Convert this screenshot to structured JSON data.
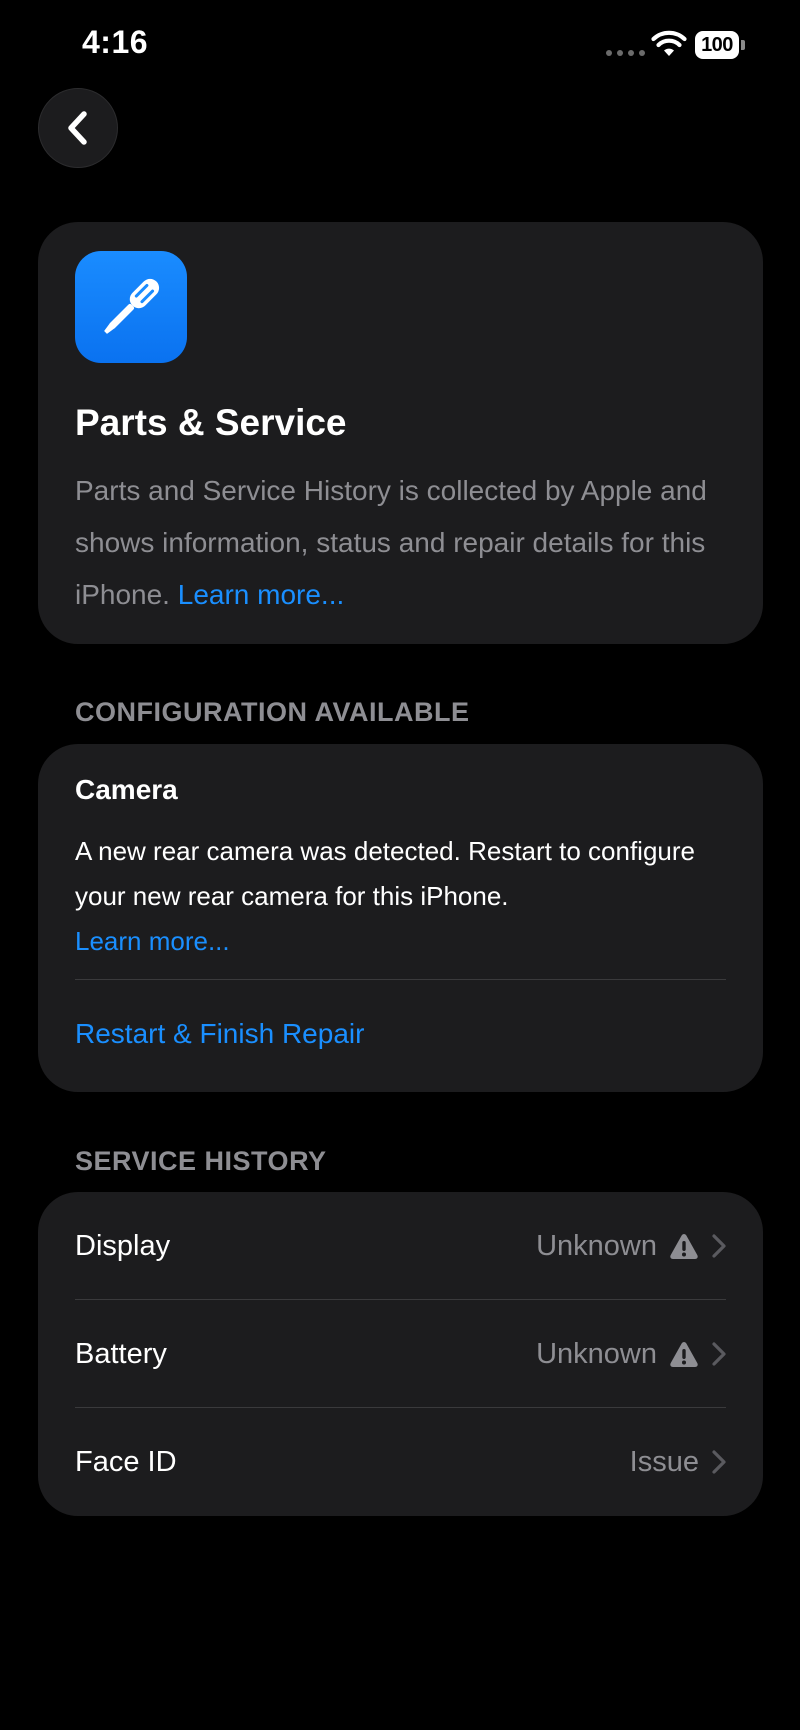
{
  "status_bar": {
    "time": "4:16",
    "battery": "100"
  },
  "hero": {
    "title": "Parts & Service",
    "description": "Parts and Service History is collected by Apple and shows information, status and repair details for this iPhone.",
    "learn_more": "Learn more..."
  },
  "configuration": {
    "header": "CONFIGURATION AVAILABLE",
    "title": "Camera",
    "description": "A new rear camera was detected. Restart to configure your new rear camera for this iPhone.",
    "learn_more": "Learn more...",
    "action": "Restart & Finish Repair"
  },
  "service_history": {
    "header": "SERVICE HISTORY",
    "items": [
      {
        "label": "Display",
        "value": "Unknown",
        "icon": "warning-icon"
      },
      {
        "label": "Battery",
        "value": "Unknown",
        "icon": "warning-icon"
      },
      {
        "label": "Face ID",
        "value": "Issue"
      }
    ]
  },
  "colors": {
    "accent": "#1a8fff",
    "card": "#1c1c1e",
    "secondary_text": "#8e8e93",
    "icon_bg": "#0a84ff"
  }
}
